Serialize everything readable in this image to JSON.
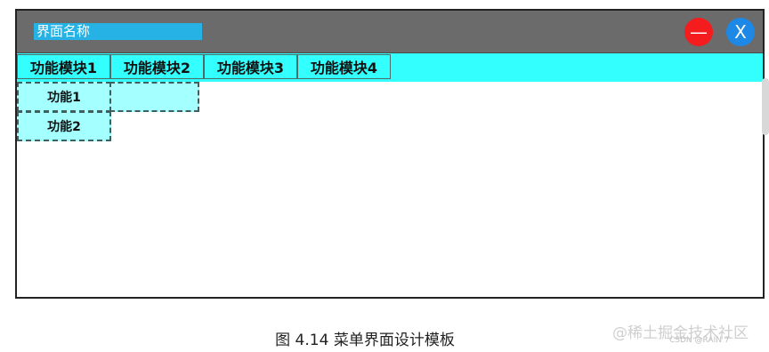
{
  "window": {
    "title": "界面名称",
    "minimize_glyph": "—",
    "close_glyph": "X"
  },
  "menu": {
    "items": [
      "功能模块1",
      "功能模块2",
      "功能模块3",
      "功能模块4"
    ]
  },
  "submenu": {
    "items": [
      "功能1",
      "功能2",
      ""
    ]
  },
  "caption": "图 4.14  菜单界面设计模板",
  "watermark": {
    "main": "@稀土掘金技术社区",
    "small": "CSDN @RAIN 7"
  },
  "colors": {
    "titlebar": "#6b6b6b",
    "title_bg": "#27b2e6",
    "minimize_btn": "#f41c1c",
    "close_btn": "#1e88e6",
    "menubar": "#33ffff",
    "submenu_bg": "#a4ffff"
  }
}
